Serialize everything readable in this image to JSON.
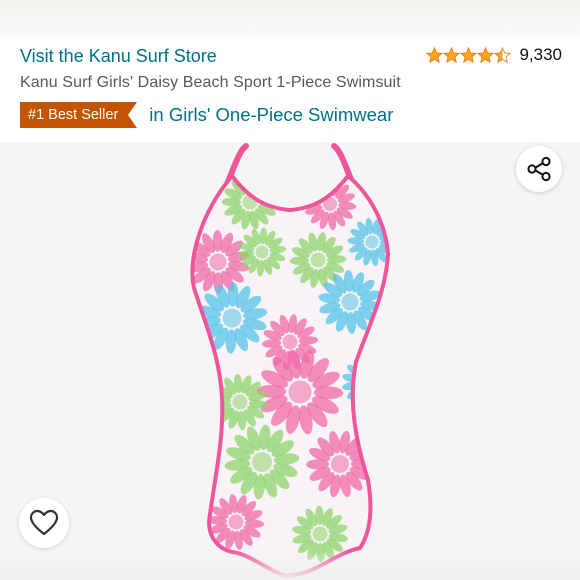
{
  "store_link": "Visit the Kanu Surf Store",
  "rating": {
    "value": 4.5,
    "max": 5,
    "count": "9,330",
    "star_color": "#ffa41c"
  },
  "product_title": "Kanu Surf Girls' Daisy Beach Sport 1-Piece Swimsuit",
  "badge": {
    "label": "#1 Best Seller",
    "color": "#c45500"
  },
  "category_link": "in Girls' One-Piece Swimwear",
  "colors": {
    "link": "#007185",
    "swimsuit_trim": "#f0549a",
    "pink": "#f06aa6",
    "green": "#8fd46b",
    "blue": "#55c3e8"
  },
  "icons": {
    "share": "share-icon",
    "favorite": "heart-outline-icon",
    "stars": "star-icon"
  }
}
